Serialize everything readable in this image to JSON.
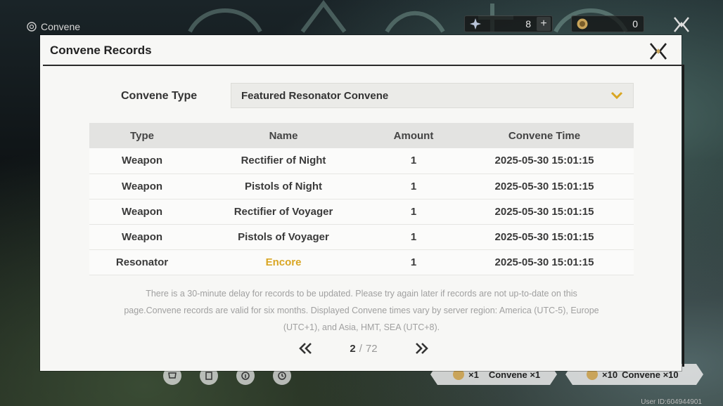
{
  "screen": {
    "title": "Convene",
    "currencies": [
      {
        "icon": "astrite-icon",
        "value": "8"
      },
      {
        "icon": "lustrous-tide-icon",
        "value": "0"
      }
    ],
    "bottom_icons": [
      "shop-icon",
      "records-icon",
      "details-icon",
      "history-icon"
    ],
    "pull_buttons": [
      {
        "count": "×1",
        "label": "Convene ×1"
      },
      {
        "count": "×10",
        "label": "Convene ×10"
      }
    ],
    "user_id": "User ID:604944901"
  },
  "modal": {
    "title": "Convene Records",
    "convene_type_label": "Convene Type",
    "convene_type_value": "Featured Resonator Convene",
    "table": {
      "headers": [
        "Type",
        "Name",
        "Amount",
        "Convene Time"
      ],
      "rows": [
        {
          "type": "Weapon",
          "name": "Rectifier of Night",
          "amount": "1",
          "time": "2025-05-30 15:01:15"
        },
        {
          "type": "Weapon",
          "name": "Pistols of Night",
          "amount": "1",
          "time": "2025-05-30 15:01:15"
        },
        {
          "type": "Weapon",
          "name": "Rectifier of Voyager",
          "amount": "1",
          "time": "2025-05-30 15:01:15"
        },
        {
          "type": "Weapon",
          "name": "Pistols of Voyager",
          "amount": "1",
          "time": "2025-05-30 15:01:15"
        },
        {
          "type": "Resonator",
          "name": "Encore",
          "amount": "1",
          "time": "2025-05-30 15:01:15"
        }
      ]
    },
    "notice_lines": [
      "There is a 30-minute delay for records to be updated. Please try again later if records are not up-to-date on this",
      "page.Convene records are valid for six months. Displayed Convene times vary by server region: America (UTC-5), Europe",
      "(UTC+1), and Asia, HMT, SEA (UTC+8)."
    ],
    "pagination": {
      "current": "2",
      "separator": "/",
      "total": "72"
    }
  },
  "colors": {
    "highlight_gold": "#d9a623",
    "modal_bg": "#f7f7f5",
    "header_bg": "#e3e3e1"
  }
}
